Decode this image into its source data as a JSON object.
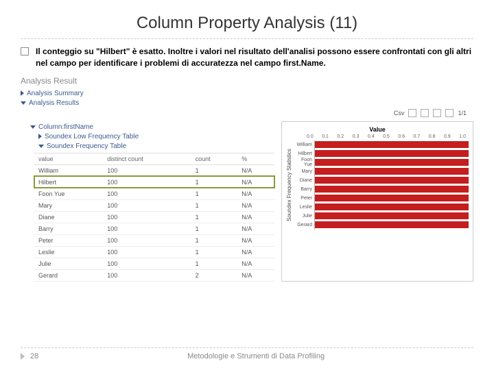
{
  "title": "Column Property Analysis (11)",
  "bullet": "Il conteggio su \"Hilbert\" è esatto. Inoltre i valori nel risultato dell'analisi possono essere confrontati con gli altri nel campo per identificare i problemi di accuratezza nel campo first.Name.",
  "section": "Analysis Result",
  "headers": {
    "summary": "Analysis Summary",
    "results": "Analysis Results",
    "column": "Column:firstName",
    "lowfreq": "Soundex Low Frequency Table",
    "freq": "Soundex Frequency Table"
  },
  "toolbar": {
    "csv": "Csv",
    "page": "1/1"
  },
  "table": {
    "cols": {
      "value": "value",
      "distinct": "distinct count",
      "count": "count",
      "pct": "%"
    },
    "rows": [
      {
        "value": "William",
        "distinct": "100",
        "count": "1",
        "pct": "N/A"
      },
      {
        "value": "Hilbert",
        "distinct": "100",
        "count": "1",
        "pct": "N/A"
      },
      {
        "value": "Foon Yue",
        "distinct": "100",
        "count": "1",
        "pct": "N/A"
      },
      {
        "value": "Mary",
        "distinct": "100",
        "count": "1",
        "pct": "N/A"
      },
      {
        "value": "Diane",
        "distinct": "100",
        "count": "1",
        "pct": "N/A"
      },
      {
        "value": "Barry",
        "distinct": "100",
        "count": "1",
        "pct": "N/A"
      },
      {
        "value": "Peter",
        "distinct": "100",
        "count": "1",
        "pct": "N/A"
      },
      {
        "value": "Leslie",
        "distinct": "100",
        "count": "1",
        "pct": "N/A"
      },
      {
        "value": "Julie",
        "distinct": "100",
        "count": "1",
        "pct": "N/A"
      },
      {
        "value": "Gerard",
        "distinct": "100",
        "count": "2",
        "pct": "N/A"
      }
    ]
  },
  "chart_data": {
    "type": "bar",
    "title": "Value",
    "ylabel": "Soundex Frequency Statistics",
    "xticks": [
      "0.0",
      "0.1",
      "0.2",
      "0.3",
      "0.4",
      "0.5",
      "0.6",
      "0.7",
      "0.8",
      "0.9",
      "1.0"
    ],
    "categories": [
      "William",
      "Hilbert",
      "Foon Yue",
      "Mary",
      "Diane",
      "Barry",
      "Peter",
      "Leslie",
      "Julie",
      "Gerard"
    ],
    "values": [
      1.0,
      1.0,
      1.0,
      1.0,
      1.0,
      1.0,
      1.0,
      1.0,
      1.0,
      1.0
    ],
    "xlim": [
      0,
      1
    ]
  },
  "footer": {
    "page": "28",
    "text": "Metodologie e Strumenti di Data Profiling"
  }
}
